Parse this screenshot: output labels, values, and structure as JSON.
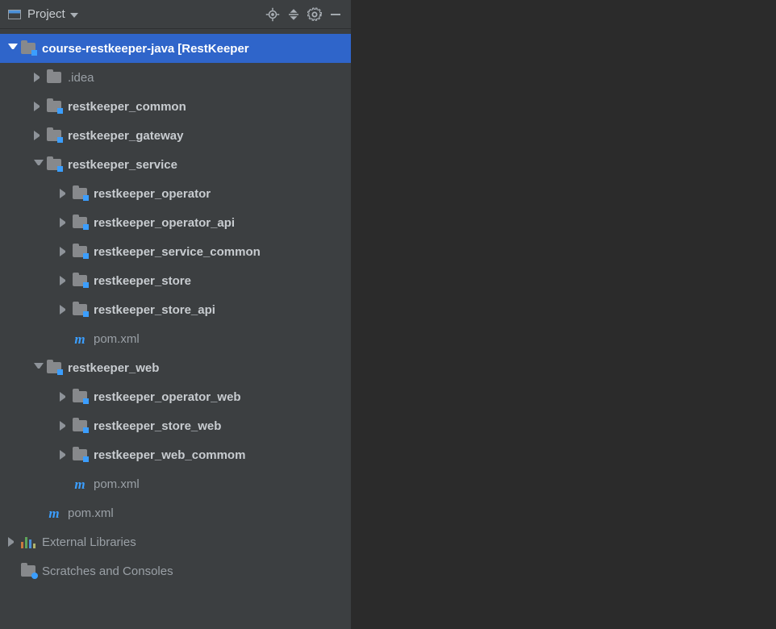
{
  "panel": {
    "title": "Project"
  },
  "icons": {
    "locate": "locate-icon",
    "expand": "expand-all-icon",
    "gear": "settings-icon",
    "hide": "hide-icon"
  },
  "tree": {
    "root": {
      "name": "course-restkeeper-java",
      "suffix": "[RestKeeper"
    },
    "idea": ".idea",
    "common": "restkeeper_common",
    "gateway": "restkeeper_gateway",
    "service": {
      "name": "restkeeper_service",
      "children": {
        "operator": "restkeeper_operator",
        "operator_api": "restkeeper_operator_api",
        "service_common": "restkeeper_service_common",
        "store": "restkeeper_store",
        "store_api": "restkeeper_store_api",
        "pom": "pom.xml"
      }
    },
    "web": {
      "name": "restkeeper_web",
      "children": {
        "operator_web": "restkeeper_operator_web",
        "store_web": "restkeeper_store_web",
        "web_common": "restkeeper_web_commom",
        "pom": "pom.xml"
      }
    },
    "root_pom": "pom.xml",
    "external": "External Libraries",
    "scratches": "Scratches and Consoles"
  }
}
